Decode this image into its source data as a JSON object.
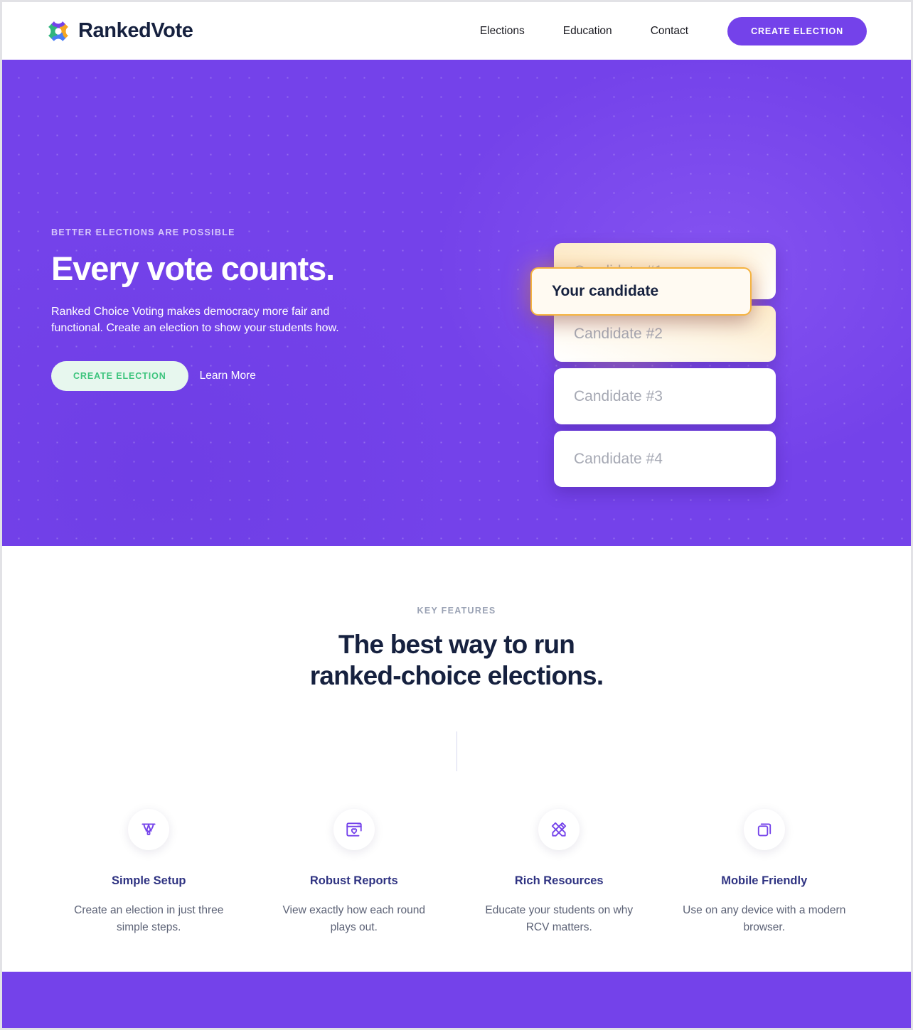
{
  "brand": {
    "name": "RankedVote",
    "logo_colors": {
      "top": "#7442ea",
      "right": "#f5a623",
      "bottom": "#4a7df5",
      "left": "#2fb57e"
    }
  },
  "nav": {
    "links": [
      {
        "label": "Elections"
      },
      {
        "label": "Education"
      },
      {
        "label": "Contact"
      }
    ],
    "cta_label": "CREATE ELECTION",
    "cta_color": "#7442ea"
  },
  "hero": {
    "background_color": "#7442ea",
    "eyebrow": "BETTER ELECTIONS ARE POSSIBLE",
    "title": "Every vote counts.",
    "subtitle": "Ranked Choice Voting makes democracy more fair and functional. Create an election to show your students how.",
    "primary_cta": "CREATE ELECTION",
    "primary_cta_color": "#3cc47c",
    "secondary_cta": "Learn More",
    "ballot": {
      "highlight_label": "Your candidate",
      "highlight_border_color": "#f5b33f",
      "candidates": [
        {
          "label": "Candidate #1"
        },
        {
          "label": "Candidate #2"
        },
        {
          "label": "Candidate #3"
        },
        {
          "label": "Candidate #4"
        }
      ]
    }
  },
  "features": {
    "kicker": "KEY FEATURES",
    "title_line1": "The best way to run",
    "title_line2": "ranked-choice elections.",
    "icon_color": "#7442ea",
    "items": [
      {
        "icon": "pen-tool-icon",
        "title": "Simple Setup",
        "desc": "Create an election in just three simple steps."
      },
      {
        "icon": "browser-heart-icon",
        "title": "Robust Reports",
        "desc": "View exactly how each round plays out."
      },
      {
        "icon": "pencil-ruler-icon",
        "title": "Rich Resources",
        "desc": "Educate your students on why RCV matters."
      },
      {
        "icon": "copy-layers-icon",
        "title": "Mobile Friendly",
        "desc": "Use on any device with a modern browser."
      }
    ]
  },
  "footer": {
    "background_color": "#7442ea"
  }
}
